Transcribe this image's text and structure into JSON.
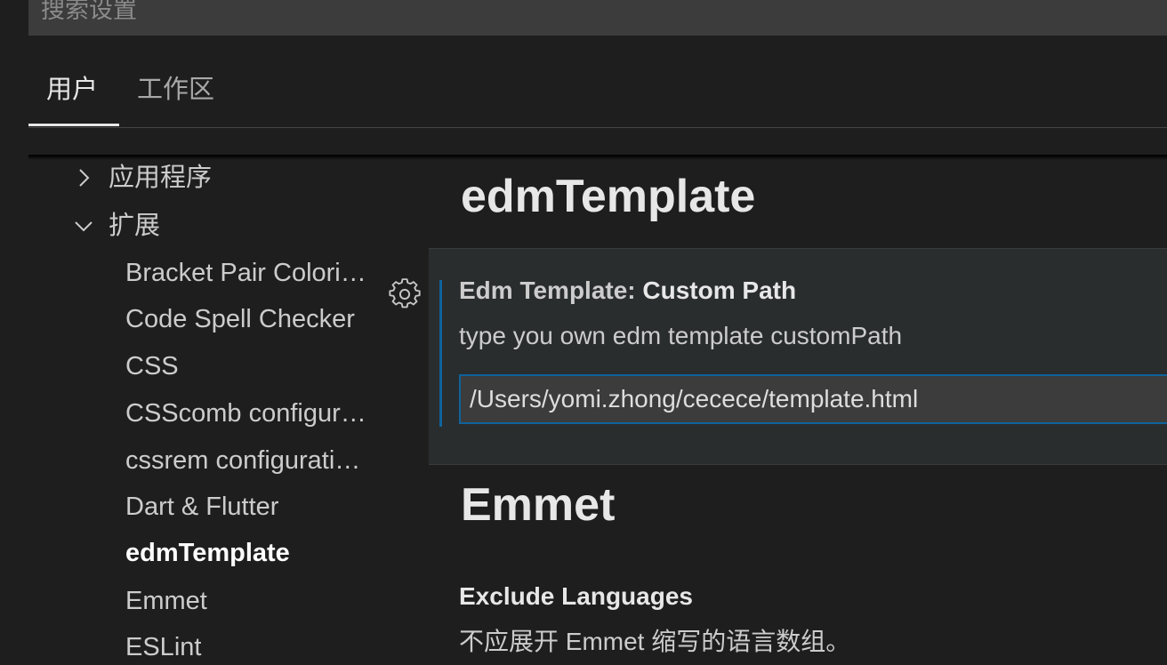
{
  "search": {
    "placeholder": "搜索设置"
  },
  "tabs": [
    {
      "label": "用户",
      "active": true
    },
    {
      "label": "工作区",
      "active": false
    }
  ],
  "toc": {
    "groups": [
      {
        "label": "应用程序",
        "expanded": false
      },
      {
        "label": "扩展",
        "expanded": true
      }
    ],
    "extensions": [
      {
        "label": "Bracket Pair Colori…"
      },
      {
        "label": "Code Spell Checker"
      },
      {
        "label": "CSS"
      },
      {
        "label": "CSScomb configur…"
      },
      {
        "label": "cssrem configurati…"
      },
      {
        "label": "Dart & Flutter"
      },
      {
        "label": "edmTemplate",
        "active": true
      },
      {
        "label": "Emmet"
      },
      {
        "label": "ESLint"
      }
    ]
  },
  "content": {
    "sections": [
      {
        "title": "edmTemplate",
        "setting": {
          "category": "Edm Template: ",
          "name": "Custom Path",
          "description": "type you own edm template customPath",
          "value": "/Users/yomi.zhong/cecece/template.html"
        }
      },
      {
        "title": "Emmet",
        "setting": {
          "name": "Exclude Languages",
          "description": "不应展开 Emmet 缩写的语言数组。"
        }
      }
    ]
  },
  "colors": {
    "background": "#1e1e1e",
    "input_background": "#3c3c3c",
    "focus_border": "#0e639c",
    "active_text": "#ffffff"
  },
  "icons": {
    "gear": "gear-icon",
    "chevron_right": "chevron-right-icon",
    "chevron_down": "chevron-down-icon"
  }
}
